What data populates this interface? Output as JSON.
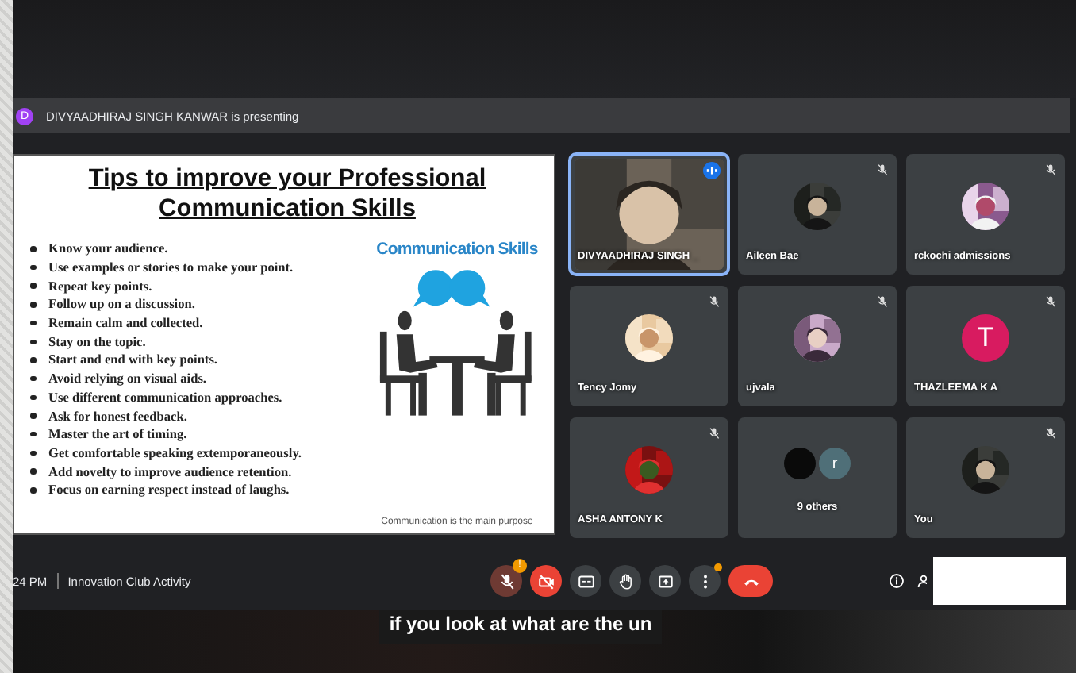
{
  "presenting_banner": {
    "avatar_letter": "D",
    "text": "DIVYAADHIRAJ SINGH KANWAR is presenting"
  },
  "slide": {
    "title": "Tips to improve your Professional Communication Skills",
    "tips": [
      "Know your audience.",
      "Use examples or stories to make your point.",
      "Repeat key points.",
      "Follow up on a discussion.",
      "Remain calm and collected.",
      "Stay on the topic.",
      "Start and end with key points.",
      "Avoid relying on visual aids.",
      "Use different communication approaches.",
      "Ask for honest feedback.",
      "Master the art of timing.",
      "Get comfortable speaking extemporaneously.",
      "Add novelty to improve audience retention.",
      "Focus on earning respect instead of laughs."
    ],
    "graphic_title": "Communication Skills",
    "caption": "Communication is the main purpose"
  },
  "tiles": [
    {
      "name": "DIVYAADHIRAJ SINGH _",
      "kind": "video",
      "muted": false,
      "speaking": true
    },
    {
      "name": "Aileen Bae",
      "muted": true,
      "speaking": false
    },
    {
      "name": "rckochi admissions",
      "muted": true,
      "speaking": false
    },
    {
      "name": "Tency Jomy",
      "muted": true,
      "speaking": false
    },
    {
      "name": "ujvala",
      "muted": true,
      "speaking": false
    },
    {
      "name": "THAZLEEMA K A",
      "kind": "letter",
      "avatar_letter": "T",
      "color": "#d81b60",
      "muted": true,
      "speaking": false
    },
    {
      "name": "ASHA ANTONY K",
      "muted": true,
      "speaking": false
    },
    {
      "name": "9 others",
      "kind": "group",
      "avatar_letter": "r",
      "color": "#4f6f78",
      "muted": false,
      "speaking": false
    },
    {
      "name": "You",
      "muted": true,
      "speaking": false
    }
  ],
  "bottom_bar": {
    "time": "24 PM",
    "meeting_name": "Innovation Club Activity",
    "controls": [
      {
        "kind": "mic",
        "off": true,
        "badge": "!"
      },
      {
        "kind": "camera",
        "off": true
      },
      {
        "kind": "captions",
        "off": false
      },
      {
        "kind": "hand",
        "off": false
      },
      {
        "kind": "present",
        "off": false
      },
      {
        "kind": "more",
        "off": false,
        "dot": true
      },
      {
        "kind": "hangup"
      }
    ]
  },
  "caption_text": "if you look at what are the un"
}
